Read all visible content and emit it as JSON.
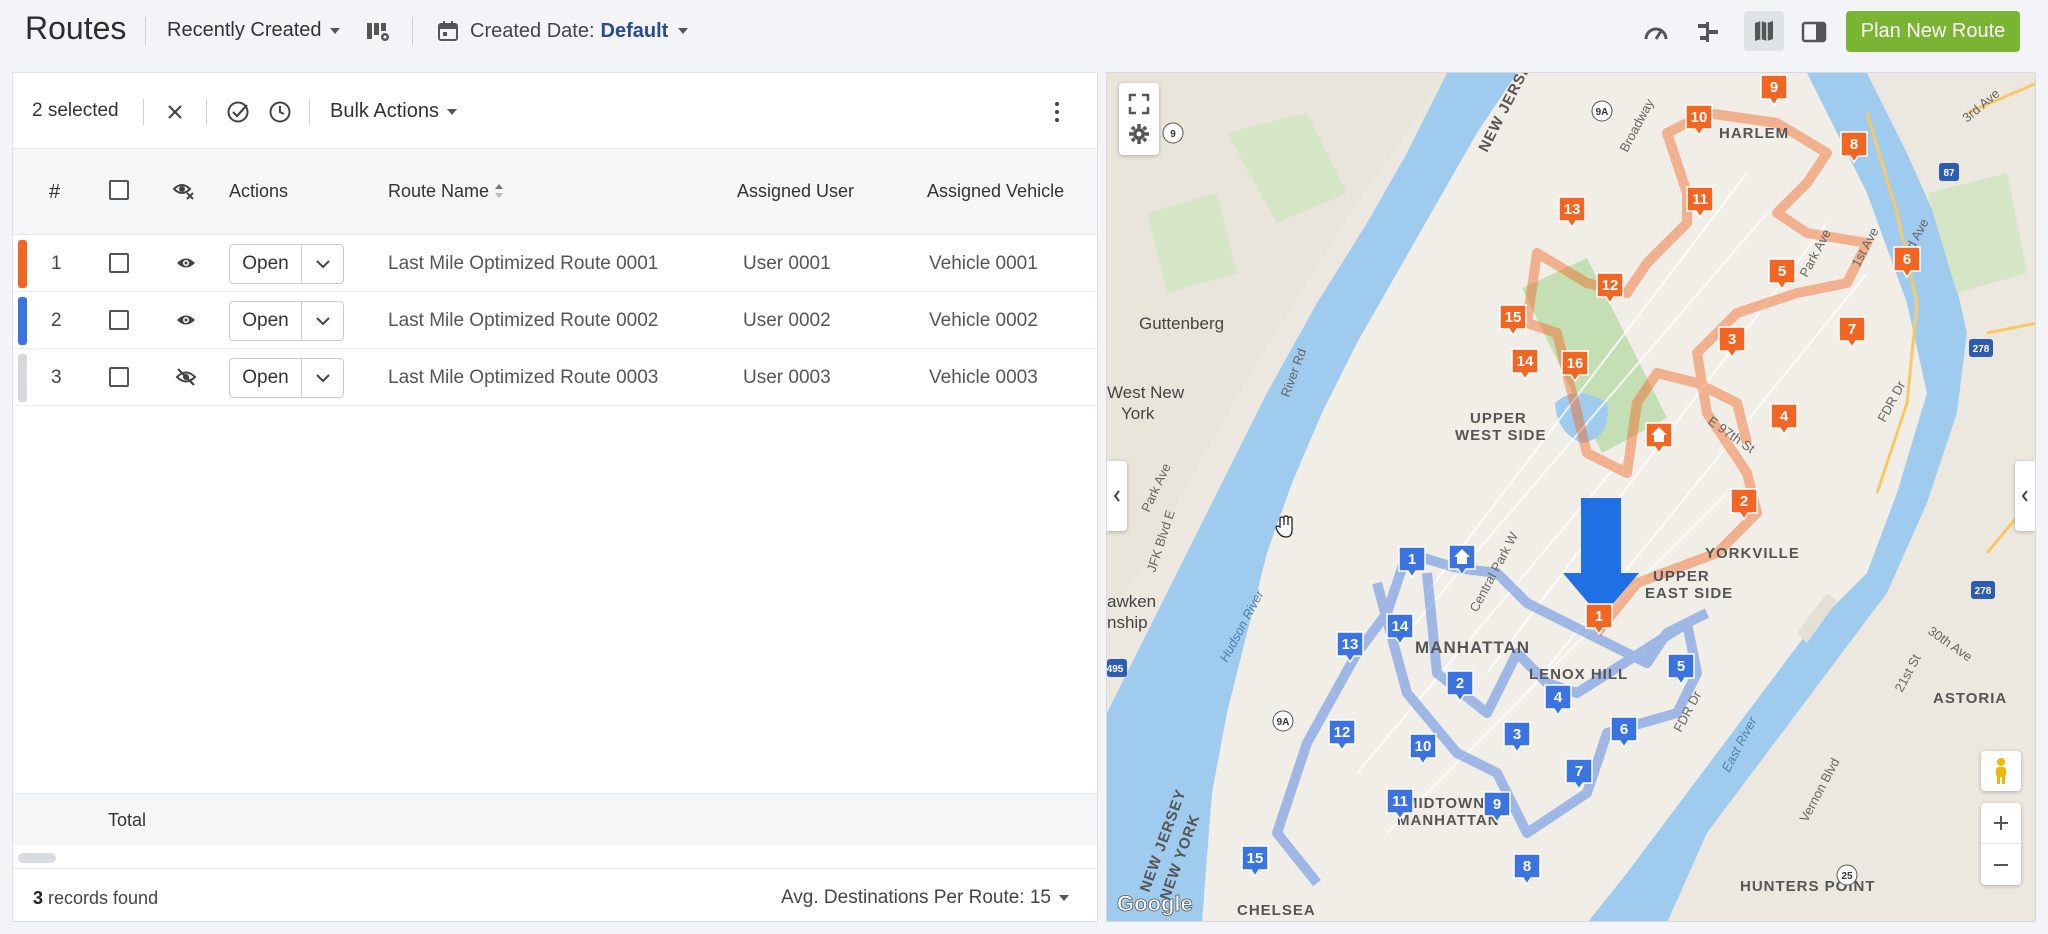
{
  "header": {
    "title": "Routes",
    "sort_label": "Recently Created",
    "date_filter_prefix": "Created Date:",
    "date_filter_value": "Default",
    "plan_button": "Plan New Route"
  },
  "selection_bar": {
    "count_label": "2 selected",
    "bulk_actions": "Bulk Actions"
  },
  "table": {
    "columns": {
      "index": "#",
      "actions": "Actions",
      "route_name": "Route Name",
      "assigned_user": "Assigned User",
      "assigned_vehicle": "Assigned Vehicle"
    },
    "rows": [
      {
        "index": "1",
        "color": "#f26522",
        "visible": true,
        "action": "Open",
        "route_name": "Last Mile Optimized Route 0001",
        "user": "User 0001",
        "vehicle": "Vehicle 0001"
      },
      {
        "index": "2",
        "color": "#3b73e0",
        "visible": true,
        "action": "Open",
        "route_name": "Last Mile Optimized Route 0002",
        "user": "User 0002",
        "vehicle": "Vehicle 0002"
      },
      {
        "index": "3",
        "color": "#d7d9dc",
        "visible": false,
        "action": "Open",
        "route_name": "Last Mile Optimized Route 0003",
        "user": "User 0003",
        "vehicle": "Vehicle 0003"
      }
    ],
    "total_label": "Total"
  },
  "footer": {
    "records_count": "3",
    "records_suffix": " records found",
    "avg_label": "Avg. Destinations Per Route: 15"
  },
  "map": {
    "place_labels": {
      "guttenberg": "Guttenberg",
      "west_new_york_1": "West New",
      "west_new_york_2": "York",
      "upper_west_1": "UPPER",
      "upper_west_2": "WEST SIDE",
      "upper_east_1": "UPPER",
      "upper_east_2": "EAST SIDE",
      "harlem": "HARLEM",
      "yorkville": "YORKVILLE",
      "manhattan": "MANHATTAN",
      "midtown_1": "MIDTOWN",
      "midtown_2": "MANHATTAN",
      "lenox_hill": "LENOX HILL",
      "astoria": "ASTORIA",
      "hunters_point": "HUNTERS POINT",
      "chelsea": "CHELSEA",
      "weehawken_1": "awken",
      "weehawken_2": "nship",
      "new_jersey": "NEW JERSEY",
      "nj_ny_1": "NEW JERSEY",
      "nj_ny_2": "NEW YORK",
      "hudson_river": "Hudson River",
      "east_river": "East River",
      "river_rd": "River Rd",
      "park_ave_nj": "Park Ave",
      "jfk_blvd": "JFK Blvd E",
      "broadway": "Broadway",
      "park_ave": "Park Ave",
      "first_ave": "1st Ave",
      "second_ave": "2nd Ave",
      "third_ave": "3rd Ave",
      "fdr_dr": "FDR Dr",
      "fdr_dr_2": "FDR Dr",
      "central_park_w": "Central Park W",
      "e97": "E 97th St",
      "thirtieth_ave": "30th Ave",
      "twentyfirst_st": "21st St",
      "vernon_blvd": "Vernon Blvd",
      "google": "Google"
    },
    "shields": [
      "9",
      "9A",
      "87",
      "278",
      "278",
      "495",
      "9A",
      "25"
    ],
    "routes": {
      "orange": {
        "color": "#f26522",
        "home_icon": "home-icon"
      },
      "blue": {
        "color": "#3b73e0",
        "home_icon": "home-icon"
      }
    }
  }
}
